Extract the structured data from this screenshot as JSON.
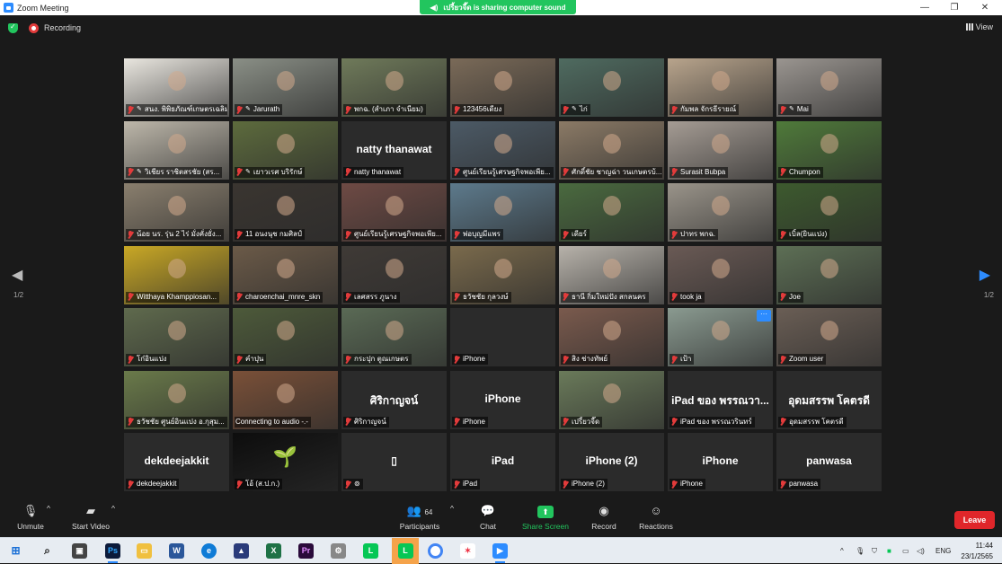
{
  "window": {
    "title": "Zoom Meeting"
  },
  "share_banner": "เปรี้ยวจี๊ด is sharing computer sound",
  "topbar": {
    "recording_label": "Recording",
    "view_label": "View"
  },
  "pager": {
    "left_indicator": "1/2",
    "right_indicator": "1/2"
  },
  "tiles": [
    {
      "name": "สนง. พิพิธภัณฑ์เกษตรเฉลิม",
      "type": "video",
      "bg": "#e9e6df",
      "pin": true
    },
    {
      "name": "Jarurath",
      "type": "video",
      "bg": "#8a8f86",
      "pin": true
    },
    {
      "name": "พกฉ. (สำเภา จำเนียม)",
      "type": "video",
      "bg": "#6f7a5a",
      "pin": false
    },
    {
      "name": "123456เดียง",
      "type": "video",
      "bg": "#7a6a58"
    },
    {
      "name": "ไก่",
      "type": "video",
      "bg": "#4f6b60",
      "pin": true
    },
    {
      "name": "กัมพล จักรธีรายณ์",
      "type": "video",
      "bg": "#b8a48c"
    },
    {
      "name": "Mai",
      "type": "video",
      "bg": "#9a9590",
      "pin": true
    },
    {
      "name": "วิเชียร ราชิตสรชัย (สร...",
      "type": "video",
      "bg": "#bdb7aa",
      "pin": true
    },
    {
      "name": "เยาวเรศ บริรักษ์",
      "type": "video",
      "bg": "#5d6b3d",
      "pin": true
    },
    {
      "name": "natty thanawat",
      "type": "text",
      "big": "natty thanawat"
    },
    {
      "name": "ศูนย์เรียนรู้เศรษฐกิจพอเพีย...",
      "type": "video",
      "bg": "#4c5a66"
    },
    {
      "name": "ศักดิ์ชัย ชาญฉ่า วนเกษตรบ้...",
      "type": "video",
      "bg": "#8b7a66"
    },
    {
      "name": "Surasit Bubpa",
      "type": "video",
      "bg": "#a59c94"
    },
    {
      "name": "Chumpon",
      "type": "video",
      "bg": "#4f7a3a"
    },
    {
      "name": "น้อย นร. รุ่น 2 ไร่ มั่งคั่งยั่ง...",
      "type": "video",
      "bg": "#8a7f6e"
    },
    {
      "name": "11 อนงนุช กมศิลป์",
      "type": "video",
      "bg": "#3a3530"
    },
    {
      "name": "ศูนย์เรียนรู้เศรษฐกิจพอเพีย...",
      "type": "video",
      "bg": "#6e4a44"
    },
    {
      "name": "พ่อบุญมีแพร",
      "type": "video",
      "bg": "#5d7a8c"
    },
    {
      "name": "เดียร์",
      "type": "video",
      "bg": "#4a6a3f"
    },
    {
      "name": "ปาทร พกฉ.",
      "type": "video",
      "bg": "#9a948a"
    },
    {
      "name": "เบิ้ล(ยินแปง)",
      "type": "video",
      "bg": "#3d5a2e"
    },
    {
      "name": "Witthaya Khamppiosan...",
      "type": "video",
      "bg": "#c9a825"
    },
    {
      "name": "charoenchai_mnre_skn",
      "type": "video",
      "bg": "#6b5a48"
    },
    {
      "name": "เลศสรร ภูนาง",
      "type": "video",
      "bg": "#3f3a36"
    },
    {
      "name": "ธวัชชัย กุลวงษ์",
      "type": "video",
      "bg": "#7a6a4c",
      "speaking": true
    },
    {
      "name": "ธานี กิ่มใหม่ปัง สกลนคร",
      "type": "video",
      "bg": "#b7b2aa"
    },
    {
      "name": "took ja",
      "type": "video",
      "bg": "#6a5a55"
    },
    {
      "name": "Joe",
      "type": "video",
      "bg": "#5d6f55"
    },
    {
      "name": "โก๋อินแปง",
      "type": "video",
      "bg": "#5f6a4d"
    },
    {
      "name": "คำปุน",
      "type": "video",
      "bg": "#4d5a3a"
    },
    {
      "name": "กระปุก ตูณเกษตร",
      "type": "video",
      "bg": "#5a6a55"
    },
    {
      "name": "iPhone",
      "type": "blank"
    },
    {
      "name": "สิง ช่างทัพย์",
      "type": "video",
      "bg": "#7a5a4d"
    },
    {
      "name": "เป้า",
      "type": "video",
      "bg": "#8a9a90",
      "more": true
    },
    {
      "name": "Zoom user",
      "type": "video",
      "bg": "#6a5e55"
    },
    {
      "name": "ธวัชชัย ศูนย์อินแปง อ.กุสุม...",
      "type": "video",
      "bg": "#6a7a4a"
    },
    {
      "name": "Connecting to audio -.-",
      "type": "video",
      "bg": "#7a5038",
      "nomic": true
    },
    {
      "name": "ศิริกาญจน์",
      "type": "text",
      "big": "ศิริกาญจน์"
    },
    {
      "name": "iPhone",
      "type": "text",
      "big": "iPhone"
    },
    {
      "name": "เปรี้ยวจี๊ด",
      "type": "video",
      "bg": "#6a7a5a"
    },
    {
      "name": "iPad ของ พรรณวรินทร์",
      "type": "text",
      "big": "iPad ของ พรรณวา..."
    },
    {
      "name": "อุดมสรรพ โคตรดี",
      "type": "text",
      "big": "อุดมสรรพ โคตรดี"
    },
    {
      "name": "dekdeejakkit",
      "type": "text",
      "big": "dekdeejakkit"
    },
    {
      "name": "โอ้ (ส.ป.ก.)",
      "type": "video",
      "bg": "#0d0d0d",
      "sprout": true
    },
    {
      "name": "⊚",
      "type": "text",
      "big": "▯"
    },
    {
      "name": "iPad",
      "type": "text",
      "big": "iPad"
    },
    {
      "name": "iPhone (2)",
      "type": "text",
      "big": "iPhone (2)"
    },
    {
      "name": "iPhone",
      "type": "text",
      "big": "iPhone"
    },
    {
      "name": "panwasa",
      "type": "text",
      "big": "panwasa"
    }
  ],
  "toolbar": {
    "unmute": "Unmute",
    "start_video": "Start Video",
    "participants": "Participants",
    "participant_count": "64",
    "chat": "Chat",
    "share_screen": "Share Screen",
    "record": "Record",
    "reactions": "Reactions",
    "leave": "Leave"
  },
  "taskbar": {
    "language": "ENG",
    "time": "11:44",
    "date": "23/1/2565"
  }
}
